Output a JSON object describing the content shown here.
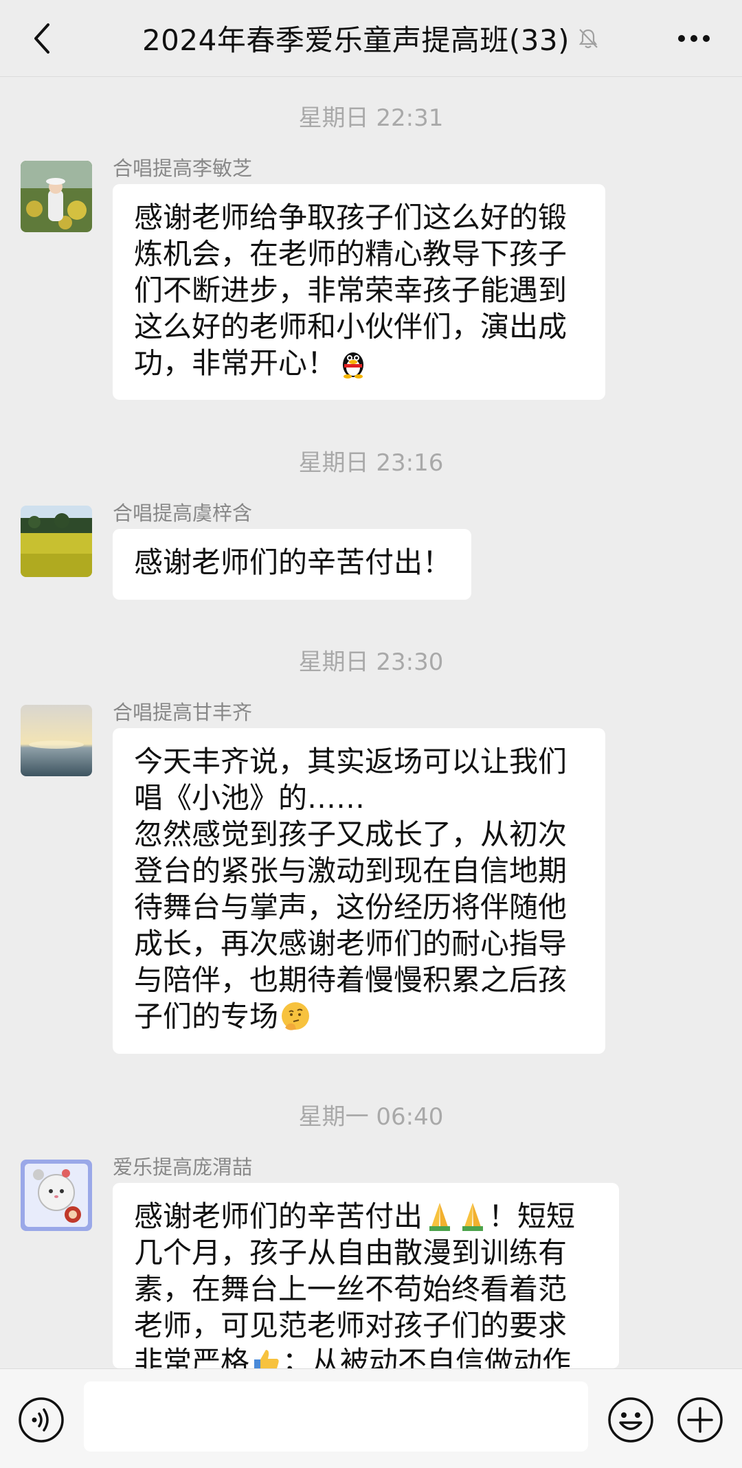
{
  "header": {
    "title": "2024年春季爱乐童声提高班(33)"
  },
  "messages": [
    {
      "time": "星期日 22:31",
      "sender": "合唱提高李敏芝",
      "lines": [
        "感谢老师给争取孩子们这么好的锻",
        "炼机会，在老师的精心教导下孩子",
        "们不断进步，非常荣幸孩子能遇到",
        "这么好的老师和小伙伴们，演出成",
        "功，非常开心！"
      ],
      "emoji": "penguin-emoji"
    },
    {
      "time": "星期日 23:16",
      "sender": "合唱提高虞梓含",
      "lines": [
        "感谢老师们的辛苦付出！"
      ]
    },
    {
      "time": "星期日 23:30",
      "sender": "合唱提高甘丰齐",
      "lines": [
        "今天丰齐说，其实返场可以让我们",
        "唱《小池》的……",
        "忽然感觉到孩子又成长了，从初次",
        "登台的紧张与激动到现在自信地期",
        "待舞台与掌声，这份经历将伴随他",
        "成长，再次感谢老师们的耐心指导",
        "与陪伴，也期待着慢慢积累之后孩",
        "子们的专场"
      ],
      "emoji": "thinking-emoji"
    },
    {
      "time": "星期一 06:40",
      "sender": "爱乐提高庞渭喆",
      "lines": [
        "感谢老师们的辛苦付出",
        "几个月，孩子从自由散漫到训练有",
        "素，在舞台上一丝不苟始终看着范",
        "老师，可见范老师对孩子们的要求",
        "非常严格",
        "从被动不自信做动作"
      ],
      "line1_tail": "！短短",
      "line5_tail": "；"
    }
  ],
  "input": {
    "placeholder": ""
  },
  "colors": {
    "background": "#ededed",
    "bubble": "#ffffff",
    "time_text": "#a9a9a9",
    "sender_text": "#888888"
  }
}
